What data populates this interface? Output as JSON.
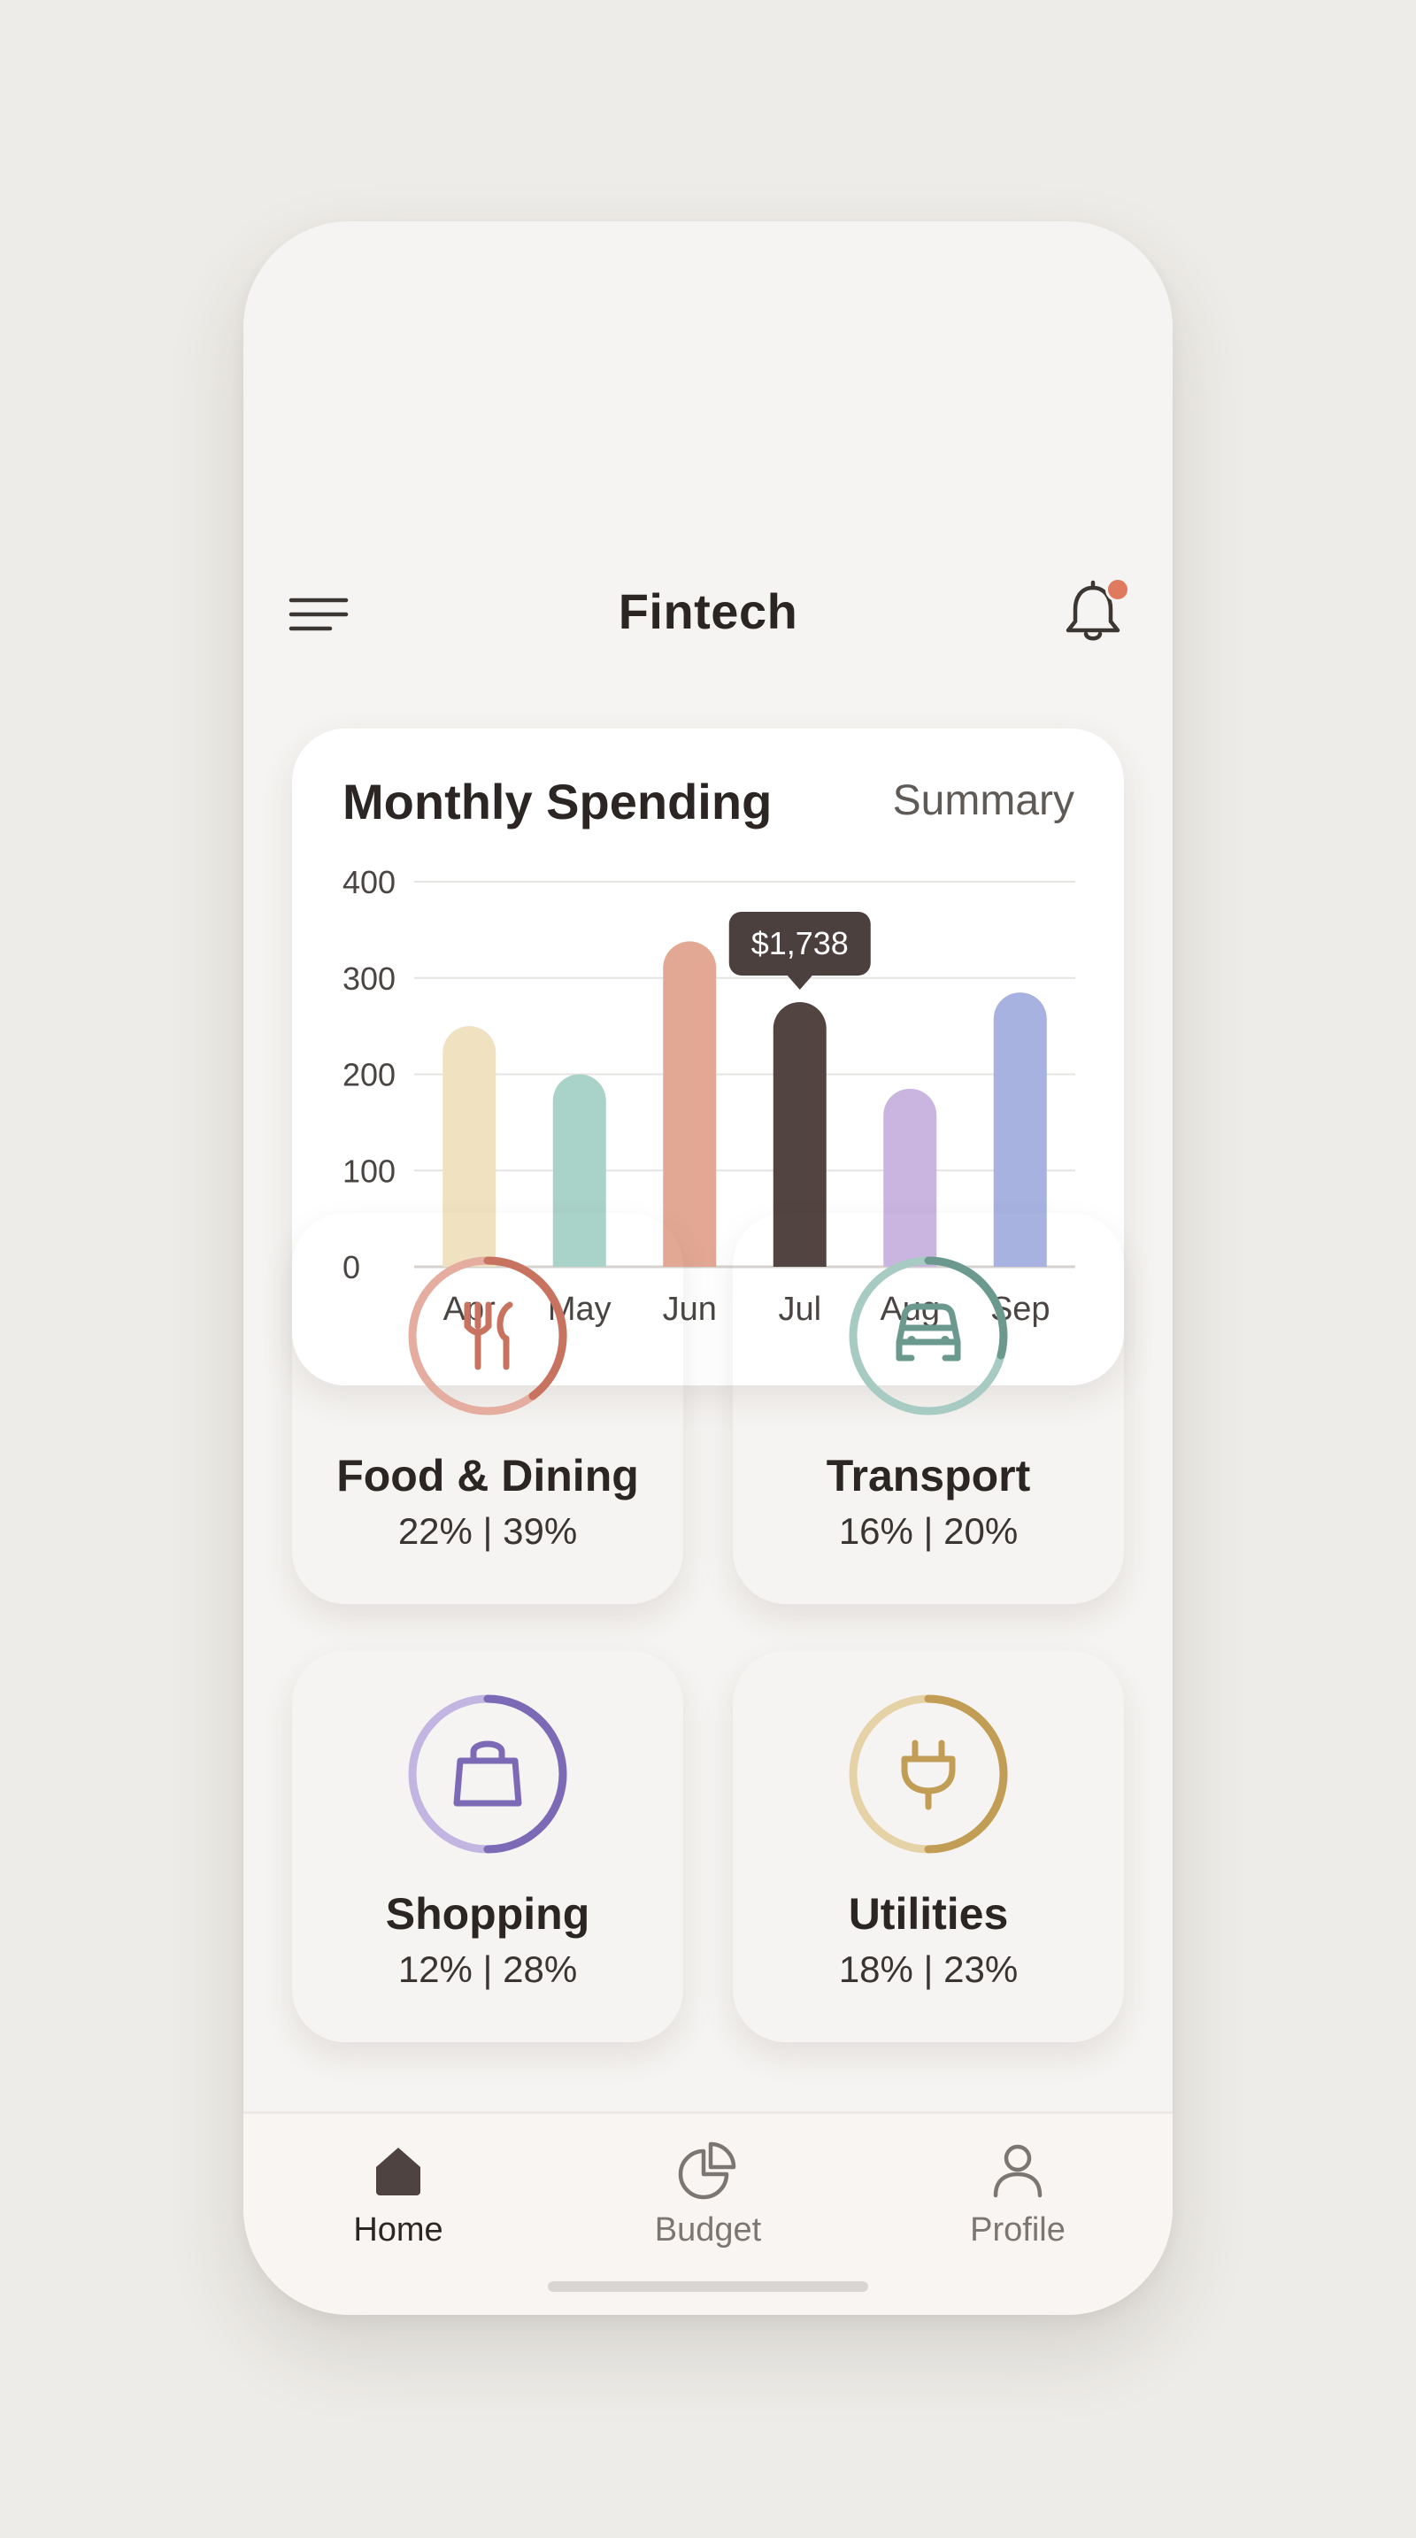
{
  "header": {
    "title": "Fintech",
    "menu_icon": "hamburger-menu-icon",
    "notification_icon": "bell-icon",
    "notification_badge_color": "#e07a5f"
  },
  "spending_card": {
    "title": "Monthly Spending",
    "summary_link": "Summary",
    "tooltip": "$1,738"
  },
  "chart_data": {
    "type": "bar",
    "categories": [
      "Apr",
      "May",
      "Jun",
      "Jul",
      "Aug",
      "Sep"
    ],
    "values": [
      250,
      200,
      338,
      275,
      185,
      285
    ],
    "colors": [
      "#f0e2c0",
      "#a9d2c8",
      "#e2a893",
      "#524541",
      "#c9b5df",
      "#a8b2e0"
    ],
    "highlight_index": 3,
    "yticks": [
      0,
      100,
      200,
      300,
      400
    ],
    "ylim": [
      0,
      400
    ],
    "grid": true
  },
  "categories": [
    {
      "name": "Food & Dining",
      "values": "22% | 39%",
      "icon": "fork-knife-icon",
      "bg": "#f5dbd2",
      "accent": "#c8735f",
      "track": "#e4ada0",
      "progress": 0.39
    },
    {
      "name": "Transport",
      "values": "16% | 20%",
      "icon": "car-icon",
      "bg": "#d4e5e2",
      "accent": "#6c998e",
      "track": "#a7cbc3",
      "progress": 0.2
    },
    {
      "name": "Shopping",
      "values": "12% | 28%",
      "icon": "shopping-bag-icon",
      "bg": "#e0dbf0",
      "accent": "#7d6ab6",
      "track": "#c2b5e2",
      "progress": 0.5
    },
    {
      "name": "Utilities",
      "values": "18% | 23%",
      "icon": "plug-icon",
      "bg": "#f3e6c9",
      "accent": "#c29d55",
      "track": "#e5d2a7",
      "progress": 0.5
    }
  ],
  "bottom_nav": [
    {
      "label": "Home",
      "icon": "home-icon",
      "active": true
    },
    {
      "label": "Budget",
      "icon": "pie-chart-icon",
      "active": false
    },
    {
      "label": "Profile",
      "icon": "user-icon",
      "active": false
    }
  ]
}
